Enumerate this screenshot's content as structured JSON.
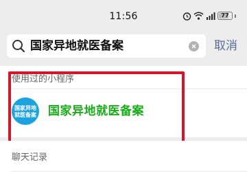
{
  "status_bar": {
    "time": "11:56",
    "battery": "77"
  },
  "search": {
    "query": "国家异地就医备案",
    "cancel_label": "取消"
  },
  "mini_programs": {
    "header": "使用过的小程序",
    "items": [
      {
        "name": "国家异地就医备案",
        "logo_text": "国家异地\n就医备案"
      }
    ]
  },
  "chat_records": {
    "header": "聊天记录"
  },
  "colors": {
    "accent_green": "#1aad19",
    "link_blue": "#576b95",
    "highlight_red": "#d8142a",
    "logo_blue": "#1aa3e0"
  }
}
